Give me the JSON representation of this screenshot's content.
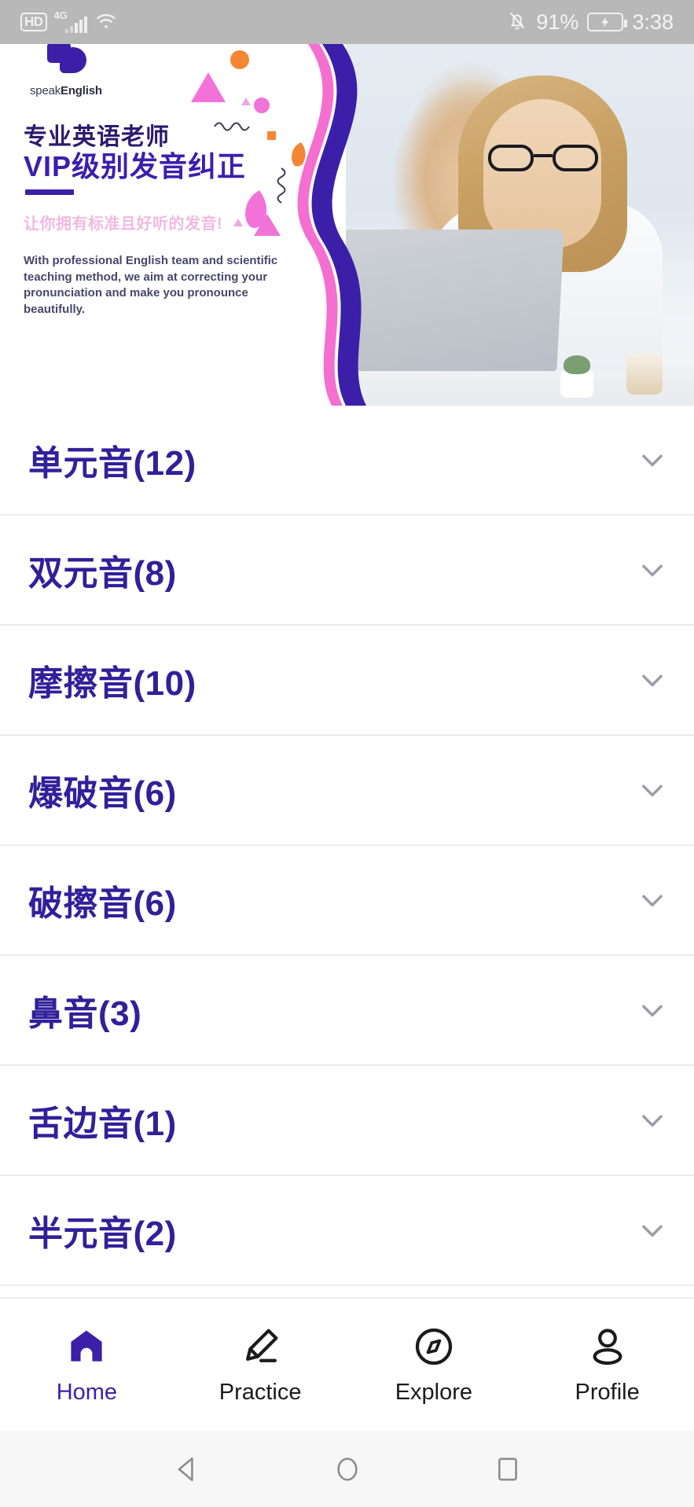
{
  "status_bar": {
    "hd_label": "HD",
    "network_label": "4G",
    "signal_icon": "signal-bars-icon",
    "wifi_icon": "wifi-icon",
    "silent_icon": "bell-muted-icon",
    "battery_percent": "91%",
    "battery_icon": "battery-charging-icon",
    "time": "3:38"
  },
  "banner": {
    "logo_text_light": "speak",
    "logo_text_bold": "English",
    "logo_icon": "speech-bubble-logo-icon",
    "headline_1": "专业英语老师",
    "headline_2": "VIP级别发音纠正",
    "subtitle": "让你拥有标准且好听的发音!",
    "paragraph": "With professional English team and scientific teaching method, we aim at correcting your pronunciation and make you pronounce beautifully.",
    "photo_alt": "teacher-with-laptop-photo",
    "colors": {
      "headline_1": "#2b1b6e",
      "headline_2": "#3a20ad",
      "subtitle": "#f3b9e0",
      "paragraph": "#47476b",
      "wave_purple": "#3b1fa8",
      "wave_pink": "#f46fd0",
      "accent_orange": "#f58634"
    }
  },
  "list": {
    "expand_icon": "chevron-down-icon",
    "items": [
      {
        "label": "单元音(12)"
      },
      {
        "label": "双元音(8)"
      },
      {
        "label": "摩擦音(10)"
      },
      {
        "label": "爆破音(6)"
      },
      {
        "label": "破擦音(6)"
      },
      {
        "label": "鼻音(3)"
      },
      {
        "label": "舌边音(1)"
      },
      {
        "label": "半元音(2)"
      }
    ],
    "label_color": "#31209a"
  },
  "tabbar": {
    "active_color": "#3b1fa8",
    "inactive_color": "#1b1b1b",
    "tabs": [
      {
        "label": "Home",
        "icon": "home-icon",
        "active": true
      },
      {
        "label": "Practice",
        "icon": "pencil-icon",
        "active": false
      },
      {
        "label": "Explore",
        "icon": "compass-icon",
        "active": false
      },
      {
        "label": "Profile",
        "icon": "person-icon",
        "active": false
      }
    ]
  },
  "system_nav": {
    "back_icon": "triangle-back-icon",
    "home_icon": "circle-home-icon",
    "recents_icon": "square-recents-icon"
  }
}
